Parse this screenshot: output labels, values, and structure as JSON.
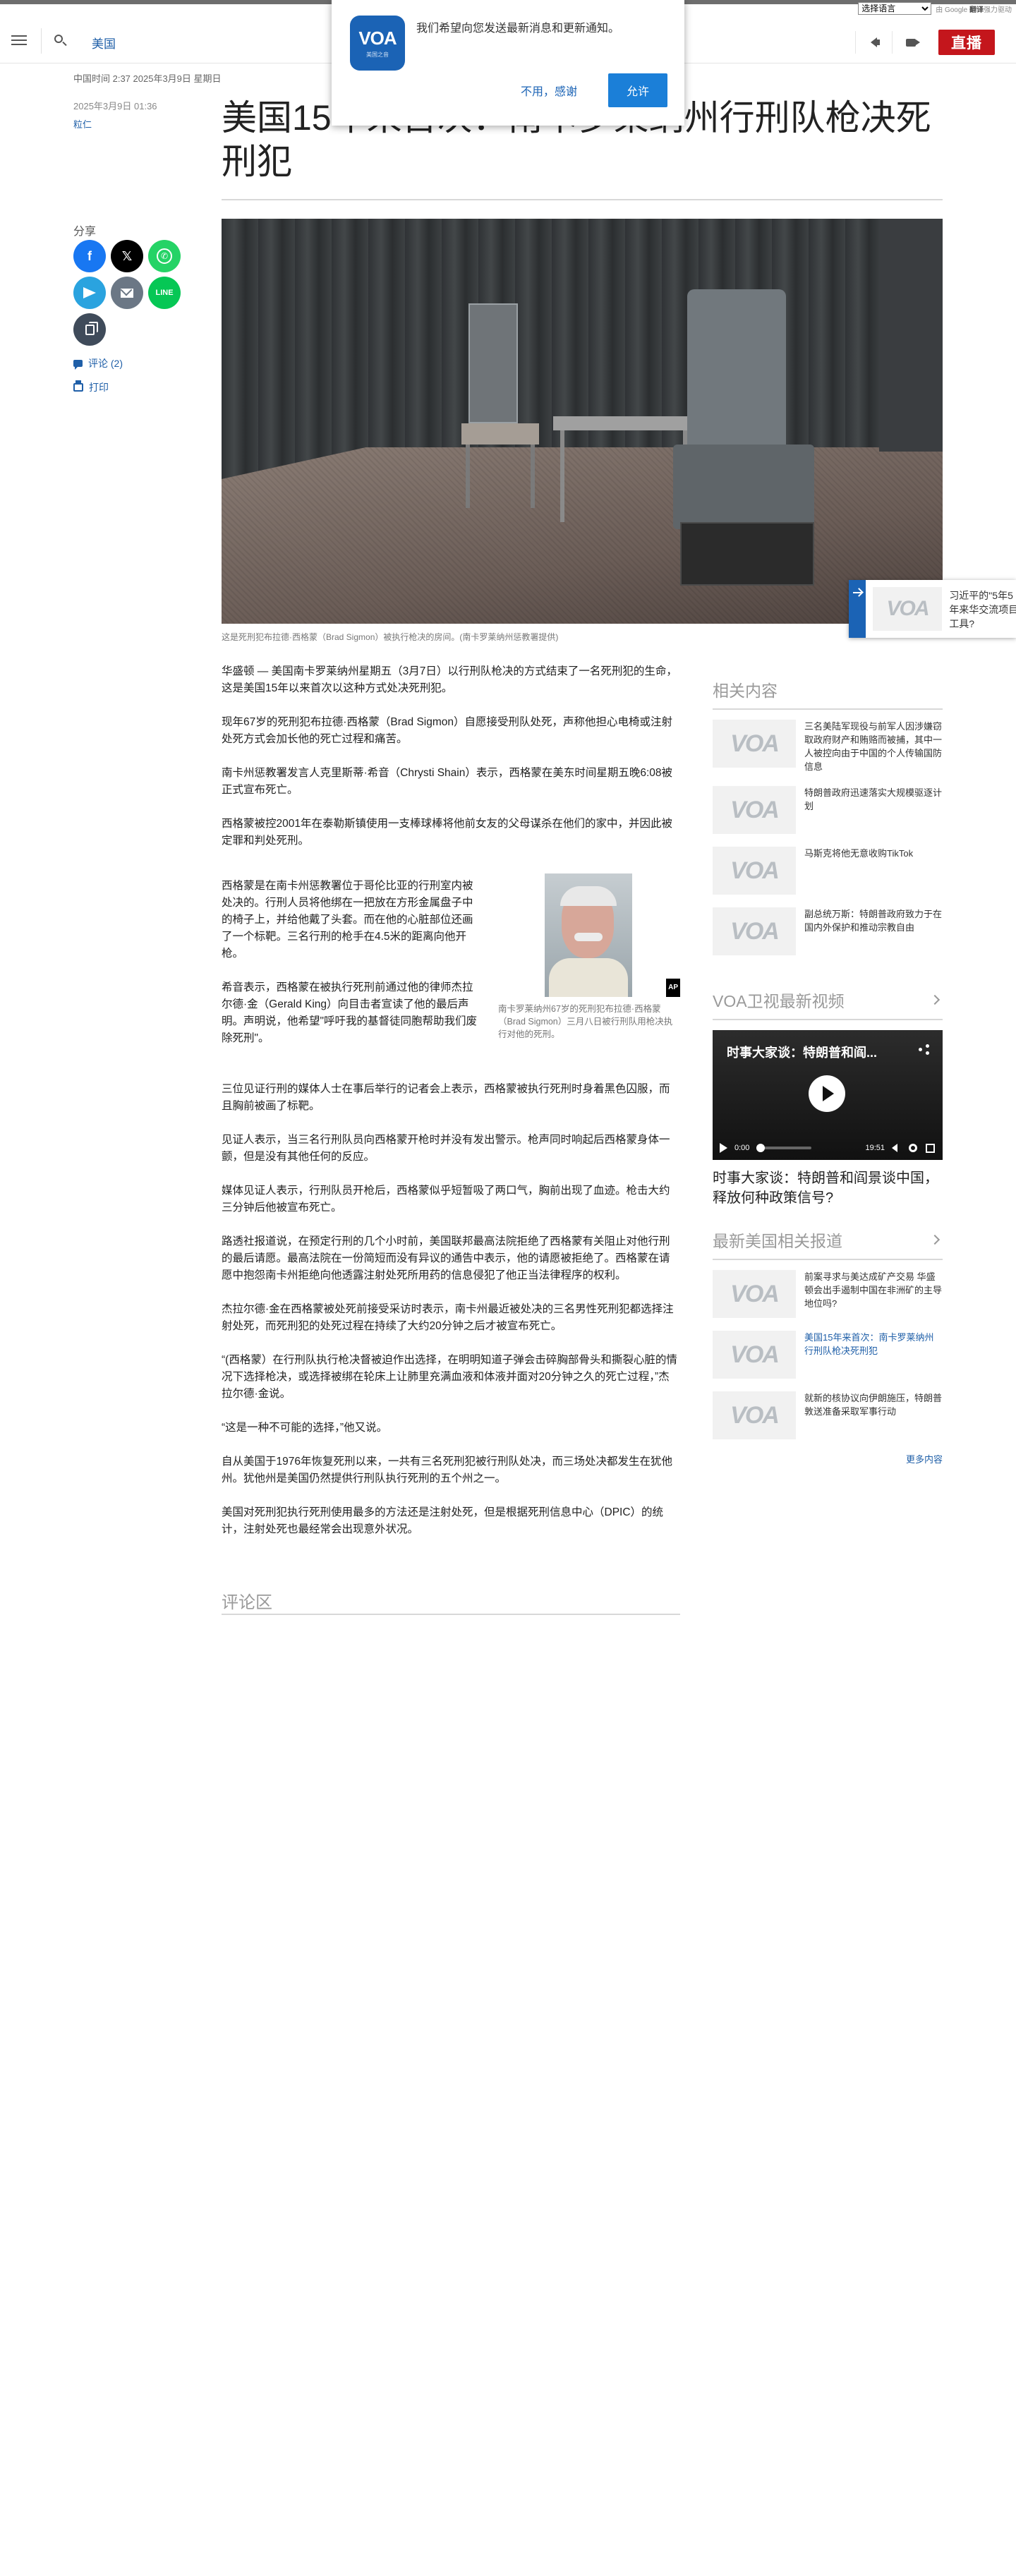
{
  "translate": {
    "select_label": "选择语言",
    "powered_prefix": "由 Google",
    "powered_brand": "翻译",
    "powered_suffix": "强力驱动"
  },
  "header": {
    "section": "美国",
    "live_label": "直播"
  },
  "notification": {
    "logo_text": "VOA",
    "logo_sub": "美国之音",
    "message": "我们希望向您发送最新消息和更新通知。",
    "deny_label": "不用，感谢",
    "allow_label": "允许"
  },
  "article": {
    "dateline": "中国时间 2:37 2025年3月9日 星期日",
    "pubdate": "2025年3月9日 01:36",
    "author": "粒仁",
    "title": "美国15年来首次：南卡罗莱纳州行刑队枪决死刑犯",
    "hero_caption": "这是死刑犯布拉德·西格蒙（Brad Sigmon）被执行枪决的房间。(南卡罗莱纳州惩教署提供)",
    "paragraphs_top": [
      "华盛顿 — 美国南卡罗莱纳州星期五（3月7日）以行刑队枪决的方式结束了一名死刑犯的生命，这是美国15年以来首次以这种方式处决死刑犯。",
      "现年67岁的死刑犯布拉德·西格蒙（Brad Sigmon）自愿接受刑队处死，声称他担心电椅或注射处死方式会加长他的死亡过程和痛苦。",
      "南卡州惩教署发言人克里斯蒂·希音（Chrysti Shain）表示，西格蒙在美东时间星期五晚6:08被正式宣布死亡。",
      "西格蒙被控2001年在泰勒斯镇使用一支棒球棒将他前女友的父母谋杀在他们的家中，并因此被定罪和判处死刑。"
    ],
    "paragraphs_wrap": [
      "西格蒙是在南卡州惩教署位于哥伦比亚的行刑室内被处决的。行刑人员将他绑在一把放在方形金属盘子中的椅子上，并给他戴了头套。而在他的心脏部位还画了一个标靶。三名行刑的枪手在4.5米的距离向他开枪。",
      "希音表示，西格蒙在被执行死刑前通过他的律师杰拉尔德·金（Gerald King）向目击者宣读了他的最后声明。声明说，他希望\"呼吁我的基督徒同胞帮助我们废除死刑\"。"
    ],
    "inline_caption": "南卡罗莱纳州67岁的死刑犯布拉德·西格蒙（Brad Sigmon）三月八日被行刑队用枪决执行对他的死刑。",
    "ap_label": "AP",
    "paragraphs_bottom": [
      "三位见证行刑的媒体人士在事后举行的记者会上表示，西格蒙被执行死刑时身着黑色囚服，而且胸前被画了标靶。",
      "见证人表示，当三名行刑队员向西格蒙开枪时并没有发出警示。枪声同时响起后西格蒙身体一颤，但是没有其他任何的反应。",
      "媒体见证人表示，行刑队员开枪后，西格蒙似乎短暂吸了两口气，胸前出现了血迹。枪击大约三分钟后他被宣布死亡。",
      "路透社报道说，在预定行刑的几个小时前，美国联邦最高法院拒绝了西格蒙有关阻止对他行刑的最后请愿。最高法院在一份简短而没有异议的通告中表示，他的请愿被拒绝了。西格蒙在请愿中抱怨南卡州拒绝向他透露注射处死所用药的信息侵犯了他正当法律程序的权利。",
      "杰拉尔德·金在西格蒙被处死前接受采访时表示，南卡州最近被处决的三名男性死刑犯都选择注射处死，而死刑犯的处死过程在持续了大约20分钟之后才被宣布死亡。",
      "“(西格蒙）在行刑队执行枪决督被迫作出选择，在明明知道子弹会击碎胸部骨头和撕裂心脏的情况下选择枪决，或选择被绑在轮床上让肺里充满血液和体液并面对20分钟之久的死亡过程，”杰拉尔德·金说。",
      "“这是一种不可能的选择，”他又说。",
      "自从美国于1976年恢复死刑以来，一共有三名死刑犯被行刑队处决，而三场处决都发生在犹他州。犹他州是美国仍然提供行刑队执行死刑的五个州之一。",
      "美国对死刑犯执行死刑使用最多的方法还是注射处死，但是根据死刑信息中心（DPIC）的统计，注射处死也最经常会出现意外状况。"
    ],
    "comments_heading": "评论区"
  },
  "share": {
    "label": "分享",
    "comments_link": "评论 (2)",
    "print_link": "打印"
  },
  "related": {
    "heading": "相关内容",
    "thumb_text": "VOA",
    "items": [
      {
        "title": "三名美陆军现役与前军人因涉嫌窃取政府财产和贿赂而被捕，其中一人被控向由于中国的个人传输国防信息"
      },
      {
        "title": "特朗普政府迅速落实大规模驱逐计划"
      },
      {
        "title": "马斯克将他无意收购TikTok"
      },
      {
        "title": "副总统万斯：特朗普政府致力于在国内外保护和推动宗教自由"
      }
    ]
  },
  "video": {
    "heading": "VOA卫视最新视频",
    "player_title": "时事大家谈：特朗普和阎...",
    "time_current": "0:00",
    "time_total": "19:51",
    "headline": "时事大家谈：特朗普和阎景谈中国，释放何种政策信号?"
  },
  "latest": {
    "heading": "最新美国相关报道",
    "items": [
      {
        "title": "前案寻求与美达成矿产交易 华盛顿会出手遏制中国在非洲矿的主导地位吗?",
        "active": false
      },
      {
        "title": "美国15年来首次：南卡罗莱纳州行刑队枪决死刑犯",
        "active": true
      },
      {
        "title": "就新的核协议向伊朗施压，特朗普敦送准备采取军事行动",
        "active": false
      }
    ],
    "more_label": "更多内容"
  },
  "float_promo": {
    "thumb_text": "VOA",
    "lines": [
      "习近平的\"5年5",
      "年来华交流项目",
      "工具?"
    ]
  },
  "colors": {
    "brand_blue": "#1b63b5",
    "link_blue": "#1f5fa8",
    "live_red": "#c4161c"
  }
}
